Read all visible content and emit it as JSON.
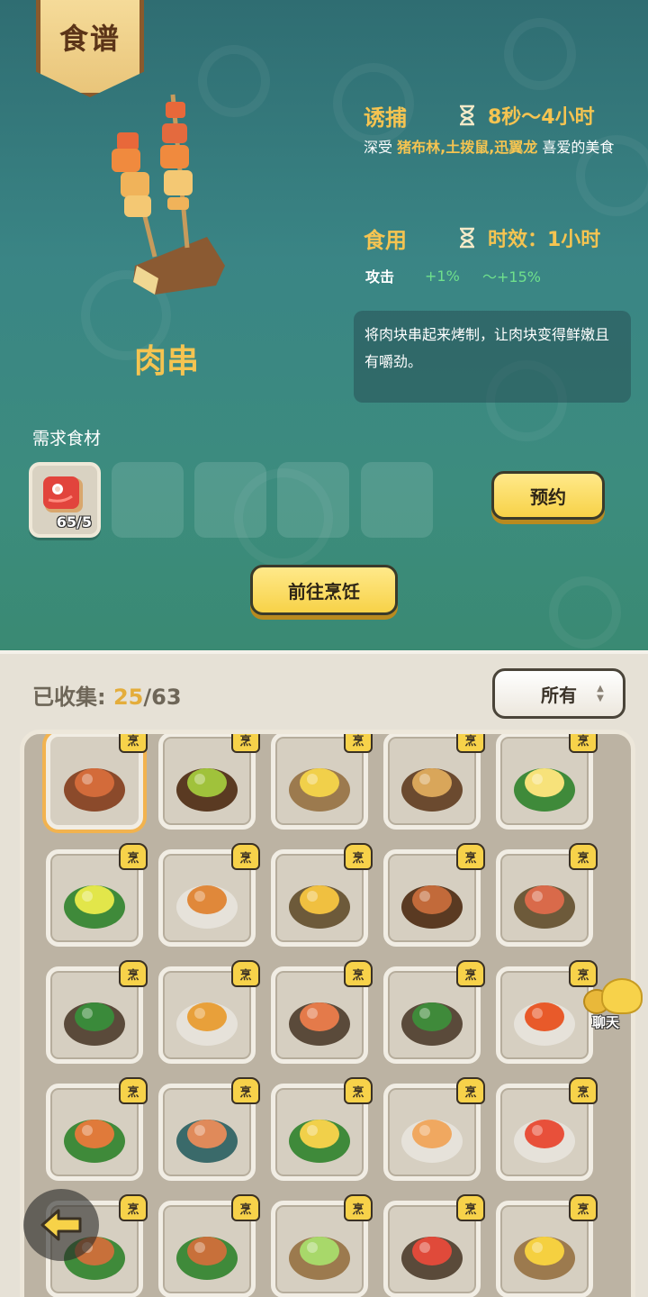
{
  "header": {
    "banner_title": "食谱"
  },
  "dish": {
    "name": "肉串",
    "lure": {
      "title": "诱捕",
      "time": "8秒～4小时",
      "desc_prefix": "深受",
      "creatures": "猪布林,土拨鼠,迅翼龙",
      "desc_suffix": "喜爱的美食"
    },
    "eat": {
      "title": "食用",
      "duration": "时效：1小时",
      "stat_name": "攻击",
      "stat_min": "+1%",
      "stat_max": "～+15%"
    },
    "description": "将肉块串起来烤制，让肉块变得鲜嫩且有嚼劲。"
  },
  "ingredients": {
    "label": "需求食材",
    "items": [
      {
        "icon": "raw-meat-icon",
        "count": "65/5"
      }
    ],
    "empty_slots": 4
  },
  "buttons": {
    "reserve": "预约",
    "go_cook": "前往烹饪"
  },
  "collection": {
    "label": "已收集:",
    "collected": "25",
    "total": "/63",
    "filter": "所有",
    "badge": "烹",
    "recipes": [
      {
        "icon": "meat-skewer-icon",
        "selected": true
      },
      {
        "icon": "mushroom-skewer-icon"
      },
      {
        "icon": "soup-bowl-icon"
      },
      {
        "icon": "grilled-fish-icon"
      },
      {
        "icon": "fried-egg-icon"
      },
      {
        "icon": "berry-salad-icon"
      },
      {
        "icon": "stew-plate-icon"
      },
      {
        "icon": "fruit-platter-icon"
      },
      {
        "icon": "mushroom-meat-skewer-icon"
      },
      {
        "icon": "seafood-platter-icon"
      },
      {
        "icon": "veggie-pepper-icon"
      },
      {
        "icon": "tomato-stew-icon"
      },
      {
        "icon": "shrimp-salad-icon"
      },
      {
        "icon": "fish-herb-plate-icon"
      },
      {
        "icon": "tomato-pasta-icon"
      },
      {
        "icon": "roast-ribs-icon"
      },
      {
        "icon": "ham-roll-icon"
      },
      {
        "icon": "cheese-plate-icon"
      },
      {
        "icon": "shrimp-noodle-icon"
      },
      {
        "icon": "tomato-egg-icon"
      },
      {
        "icon": "roast-platter-icon"
      },
      {
        "icon": "roast-drumstick-icon"
      },
      {
        "icon": "green-soup-icon"
      },
      {
        "icon": "crayfish-platter-icon"
      },
      {
        "icon": "custard-bowl-icon"
      }
    ]
  },
  "chat": {
    "label": "聊天"
  },
  "colors": {
    "accent_gold": "#f5c451",
    "green_stat": "#6fe08c",
    "button_yellow": "#f7d248"
  }
}
